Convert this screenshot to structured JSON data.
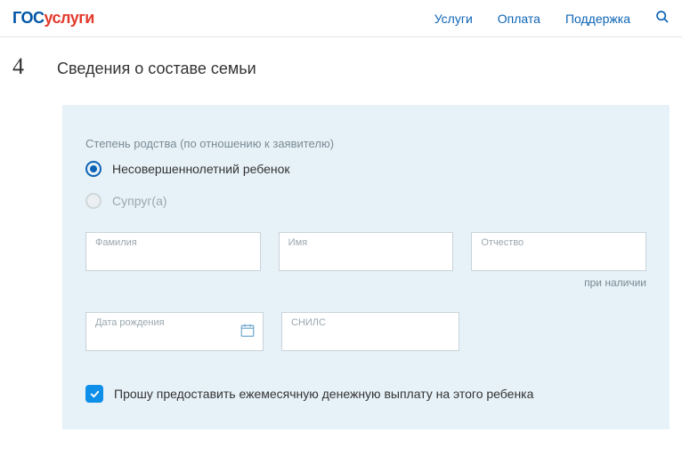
{
  "header": {
    "logo_pre": "гос",
    "logo_post": "услуги",
    "nav": {
      "services": "Услуги",
      "payment": "Оплата",
      "support": "Поддержка"
    }
  },
  "section": {
    "step_number": "4",
    "title": "Сведения о составе семьи"
  },
  "form": {
    "relationship_label": "Степень родства (по отношению к заявителю)",
    "radio_child": "Несовершеннолетний ребенок",
    "radio_spouse": "Супруг(а)",
    "surname_label": "Фамилия",
    "name_label": "Имя",
    "patronymic_label": "Отчество",
    "patronymic_hint": "при наличии",
    "birthdate_label": "Дата рождения",
    "snils_label": "СНИЛС",
    "checkbox_label": "Прошу предоставить ежемесячную денежную выплату на этого ребенка"
  }
}
